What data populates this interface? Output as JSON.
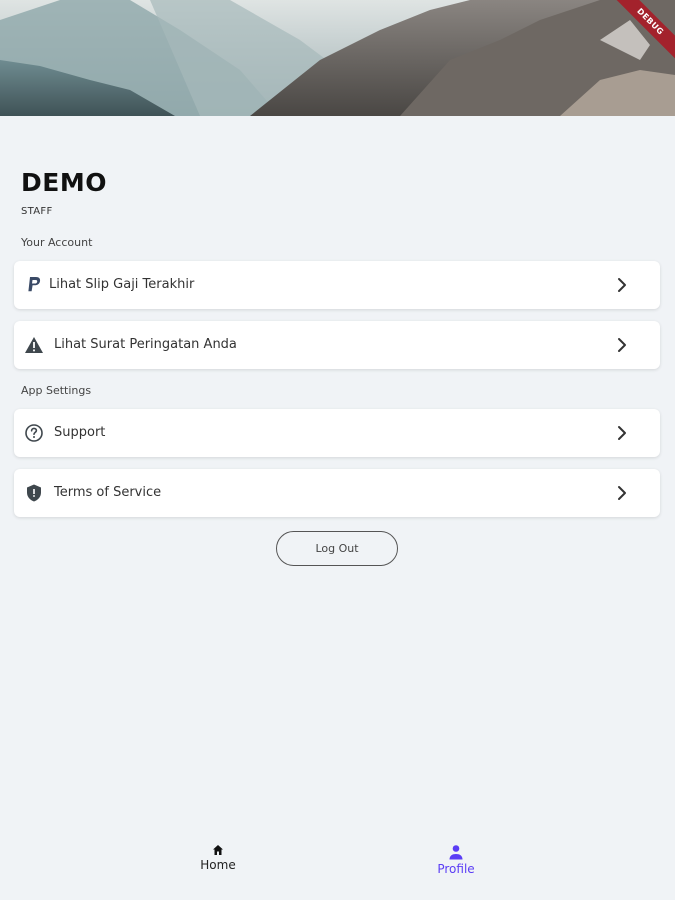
{
  "header": {
    "debug_banner": "DEBUG"
  },
  "profile": {
    "name": "DEMO",
    "role": "STAFF"
  },
  "sections": {
    "account_title": "Your Account",
    "settings_title": "App Settings"
  },
  "account_items": [
    {
      "label": "Lihat Slip Gaji Terakhir",
      "icon": "paypal-icon"
    },
    {
      "label": "Lihat Surat Peringatan Anda",
      "icon": "warning-icon"
    }
  ],
  "settings_items": [
    {
      "label": "Support",
      "icon": "help-circle-icon"
    },
    {
      "label": "Terms of Service",
      "icon": "shield-icon"
    }
  ],
  "logout_label": "Log Out",
  "bottom_nav": {
    "items": [
      {
        "label": "Home",
        "icon": "home-icon",
        "active": false
      },
      {
        "label": "Profile",
        "icon": "person-icon",
        "active": true
      }
    ]
  },
  "colors": {
    "accent": "#5b3df5",
    "background": "#f0f3f6",
    "debug_ribbon": "#a3222c"
  }
}
